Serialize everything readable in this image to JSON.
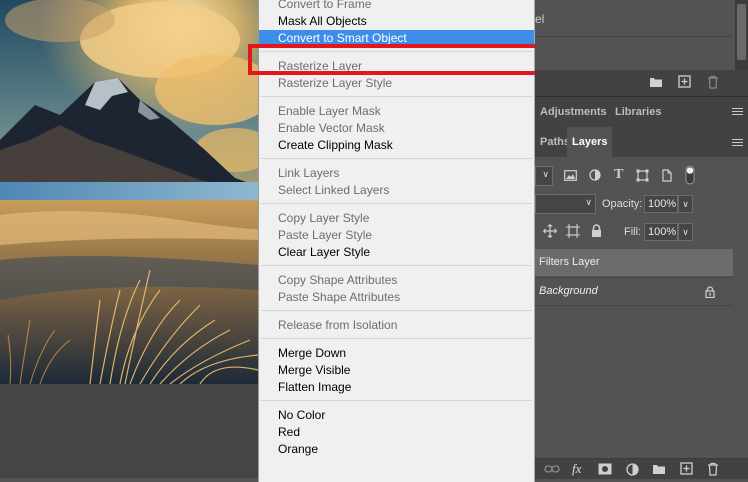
{
  "canvas": {
    "photo_description_icon": "mountain-landscape-photo"
  },
  "context_menu": {
    "groups": [
      [
        {
          "label": "Convert to Frame",
          "enabled": false
        },
        {
          "label": "Mask All Objects",
          "enabled": true
        },
        {
          "label": "Convert to Smart Object",
          "enabled": true,
          "highlighted": true
        }
      ],
      [
        {
          "label": "Rasterize Layer",
          "enabled": false
        },
        {
          "label": "Rasterize Layer Style",
          "enabled": false
        }
      ],
      [
        {
          "label": "Enable Layer Mask",
          "enabled": false
        },
        {
          "label": "Enable Vector Mask",
          "enabled": false
        },
        {
          "label": "Create Clipping Mask",
          "enabled": true
        }
      ],
      [
        {
          "label": "Link Layers",
          "enabled": false
        },
        {
          "label": "Select Linked Layers",
          "enabled": false
        }
      ],
      [
        {
          "label": "Copy Layer Style",
          "enabled": false
        },
        {
          "label": "Paste Layer Style",
          "enabled": false
        },
        {
          "label": "Clear Layer Style",
          "enabled": true
        }
      ],
      [
        {
          "label": "Copy Shape Attributes",
          "enabled": false
        },
        {
          "label": "Paste Shape Attributes",
          "enabled": false
        }
      ],
      [
        {
          "label": "Release from Isolation",
          "enabled": false
        }
      ],
      [
        {
          "label": "Merge Down",
          "enabled": true
        },
        {
          "label": "Merge Visible",
          "enabled": true
        },
        {
          "label": "Flatten Image",
          "enabled": true
        }
      ],
      [
        {
          "label": "No Color",
          "enabled": true
        },
        {
          "label": "Red",
          "enabled": true
        },
        {
          "label": "Orange",
          "enabled": true
        }
      ]
    ],
    "highlight_border_color": "#e3161b",
    "highlight_fill_color": "#3d8ee8"
  },
  "history_panel": {
    "partial_text": "el",
    "footer_icons": [
      "folder-icon",
      "new-icon",
      "trash-icon"
    ]
  },
  "panel_tabs_top": {
    "tabs": [
      "Adjustments",
      "Libraries"
    ]
  },
  "panel_tabs_layers": {
    "tabs": [
      "Paths",
      "Layers"
    ],
    "active": "Layers"
  },
  "layers_panel": {
    "opacity_label": "Opacity:",
    "opacity_value": "100%",
    "fill_label": "Fill:",
    "fill_value": "100%",
    "layers": [
      {
        "name": "Filters Layer",
        "selected": true,
        "italic": false
      },
      {
        "name": "Background",
        "selected": false,
        "italic": true,
        "locked": true
      }
    ],
    "bottom_icons": [
      "link-icon",
      "fx-icon",
      "mask-icon",
      "adjustment-icon",
      "folder-icon",
      "new-layer-icon",
      "trash-icon"
    ],
    "fx_label": "fx"
  }
}
